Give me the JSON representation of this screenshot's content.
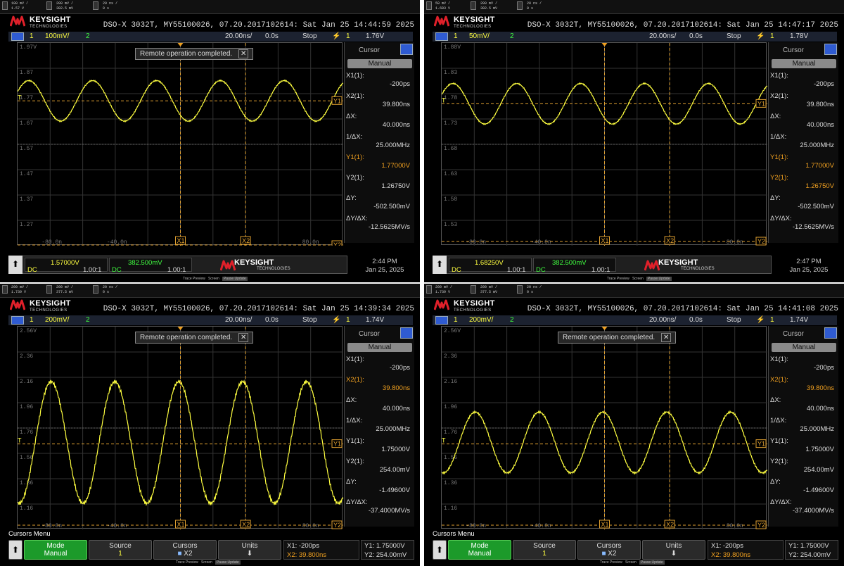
{
  "panels": [
    {
      "topbar": {
        "ch1_scale": "100 mV /",
        "ch1_offset": "1.57 V",
        "ch2_scale": "200 mV /",
        "ch2_offset": "382.5 mV",
        "time_scale": "20 ns /",
        "time_delay": "0 s"
      },
      "header": {
        "model": "DSO-X 3032T, MY55100026, 07.20.2017102614: Sat Jan 25 14:44:59 2025"
      },
      "channel_bar": {
        "ch1": "1",
        "scale": "100mV/",
        "ch2": "2",
        "timebase": "20.00ns/",
        "delay": "0.0s",
        "run": "Stop",
        "trig_ch": "1",
        "trig_level": "1.76V"
      },
      "y_labels": [
        "1.97V",
        "1.87",
        "1.77",
        "1.67",
        "1.57",
        "1.47",
        "1.37",
        "1.27"
      ],
      "x_labels": [
        "-80.0n",
        "-40.0n",
        "80.0n"
      ],
      "toast": "Remote operation completed.",
      "cursor": {
        "title": "Cursor",
        "mode": "Manual",
        "rows": [
          [
            "X1(1):",
            "-200ps"
          ],
          [
            "X2(1):",
            "39.800ns"
          ],
          [
            "ΔX:",
            "40.000ns"
          ],
          [
            "1/ΔX:",
            "25.000MHz"
          ],
          [
            "Y1(1):",
            "1.77000V"
          ],
          [
            "Y2(1):",
            "1.26750V"
          ],
          [
            "ΔY:",
            "-502.500mV"
          ],
          [
            "ΔY/ΔX:",
            "-12.5625MV/s"
          ]
        ],
        "highlight": [
          4
        ]
      },
      "markers": {
        "y1": "Y1",
        "y2": "Y2",
        "x1": "X1",
        "x2": "X2",
        "t": "T"
      },
      "bottom": {
        "ch1_offset": "1.57000V",
        "ch1_coupling": "DC",
        "ch1_probe": "1.00:1",
        "ch2_offset": "382.500mV",
        "ch2_coupling": "DC",
        "ch2_probe": "1.00:1",
        "brand": "KEYSIGHT",
        "brand_sub": "TECHNOLOGIES",
        "time": "2:44 PM",
        "date": "Jan 25, 2025"
      },
      "wave": {
        "center": 1.77,
        "amplitude": 0.07,
        "y_top": 1.97,
        "y_bottom": 1.27,
        "cycles": 5.1
      }
    },
    {
      "topbar": {
        "ch1_scale": "50 mV /",
        "ch1_offset": "1.683 V",
        "ch2_scale": "200 mV /",
        "ch2_offset": "382.5 mV",
        "time_scale": "20 ns /",
        "time_delay": "0 s"
      },
      "header": {
        "model": "DSO-X 3032T, MY55100026, 07.20.2017102614: Sat Jan 25 14:47:17 2025"
      },
      "channel_bar": {
        "ch1": "1",
        "scale": "50mV/",
        "ch2": "2",
        "timebase": "20.00ns/",
        "delay": "0.0s",
        "run": "Stop",
        "trig_ch": "1",
        "trig_level": "1.78V"
      },
      "y_labels": [
        "1.88V",
        "1.83",
        "1.78",
        "1.73",
        "1.68",
        "1.63",
        "1.58",
        "1.53"
      ],
      "x_labels": [
        "-80.0n",
        "-40.0n",
        "80.0n"
      ],
      "toast": "",
      "cursor": {
        "title": "Cursor",
        "mode": "Manual",
        "rows": [
          [
            "X1(1):",
            "-200ps"
          ],
          [
            "X2(1):",
            "39.800ns"
          ],
          [
            "ΔX:",
            "40.000ns"
          ],
          [
            "1/ΔX:",
            "25.000MHz"
          ],
          [
            "Y1(1):",
            "1.77000V"
          ],
          [
            "Y2(1):",
            "1.26750V"
          ],
          [
            "ΔY:",
            "-502.500mV"
          ],
          [
            "ΔY/ΔX:",
            "-12.5625MV/s"
          ]
        ],
        "highlight": [
          4,
          5
        ]
      },
      "markers": {
        "y1": "Y1",
        "y2": "Y2",
        "x1": "X1",
        "x2": "X2",
        "t": "T"
      },
      "bottom": {
        "ch1_offset": "1.68250V",
        "ch1_coupling": "DC",
        "ch1_probe": "1.00:1",
        "ch2_offset": "382.500mV",
        "ch2_coupling": "DC",
        "ch2_probe": "1.00:1",
        "brand": "KEYSIGHT",
        "brand_sub": "TECHNOLOGIES",
        "time": "2:47 PM",
        "date": "Jan 25, 2025"
      },
      "wave": {
        "center": 1.775,
        "amplitude": 0.035,
        "y_top": 1.88,
        "y_bottom": 1.53,
        "cycles": 5.1
      }
    },
    {
      "topbar": {
        "ch1_scale": "200 mV /",
        "ch1_offset": "1.739 V",
        "ch2_scale": "200 mV /",
        "ch2_offset": "377.5 mV",
        "time_scale": "20 ns /",
        "time_delay": "0 s"
      },
      "header": {
        "model": "DSO-X 3032T, MY55100026, 07.20.2017102614: Sat Jan 25 14:39:34 2025"
      },
      "channel_bar": {
        "ch1": "1",
        "scale": "200mV/",
        "ch2": "2",
        "timebase": "20.00ns/",
        "delay": "0.0s",
        "run": "Stop",
        "trig_ch": "1",
        "trig_level": "1.74V"
      },
      "y_labels": [
        "2.56V",
        "2.36",
        "2.16",
        "1.96",
        "1.76",
        "1.56",
        "1.36",
        "1.16"
      ],
      "x_labels": [
        "-80.0n",
        "-40.0n",
        "80.0n"
      ],
      "toast": "Remote operation completed.",
      "cursor": {
        "title": "Cursor",
        "mode": "Manual",
        "rows": [
          [
            "X1(1):",
            "-200ps"
          ],
          [
            "X2(1):",
            "39.800ns"
          ],
          [
            "ΔX:",
            "40.000ns"
          ],
          [
            "1/ΔX:",
            "25.000MHz"
          ],
          [
            "Y1(1):",
            "1.75000V"
          ],
          [
            "Y2(1):",
            "254.00mV"
          ],
          [
            "ΔY:",
            "-1.49600V"
          ],
          [
            "ΔY/ΔX:",
            "-37.4000MV/s"
          ]
        ],
        "highlight": [
          1
        ]
      },
      "markers": {
        "y1": "Y1",
        "y2": "Y2",
        "x1": "X1",
        "x2": "X2",
        "t": "T"
      },
      "menu": {
        "title": "Cursors Menu",
        "mode_label": "Mode",
        "mode_value": "Manual",
        "source_label": "Source",
        "source_value": "1",
        "cursors_label": "Cursors",
        "cursors_value": "X2",
        "units_label": "Units",
        "x1": "X1: -200ps",
        "x2": "X2: 39.800ns",
        "y1": "Y1: 1.75000V",
        "y2": "Y2: 254.00mV"
      },
      "wave": {
        "center": 1.76,
        "amplitude": 0.42,
        "y_top": 2.56,
        "y_bottom": 1.16,
        "cycles": 5.1
      }
    },
    {
      "topbar": {
        "ch1_scale": "200 mV /",
        "ch1_offset": "1.739 V",
        "ch2_scale": "200 mV /",
        "ch2_offset": "377.5 mV",
        "time_scale": "20 ns /",
        "time_delay": "0 s"
      },
      "header": {
        "model": "DSO-X 3032T, MY55100026, 07.20.2017102614: Sat Jan 25 14:41:08 2025"
      },
      "channel_bar": {
        "ch1": "1",
        "scale": "200mV/",
        "ch2": "2",
        "timebase": "20.00ns/",
        "delay": "0.0s",
        "run": "Stop",
        "trig_ch": "1",
        "trig_level": "1.74V"
      },
      "y_labels": [
        "2.56V",
        "2.36",
        "2.16",
        "1.96",
        "1.76",
        "1.56",
        "1.36",
        "1.16"
      ],
      "x_labels": [
        "-80.0n",
        "-40.0n",
        "80.0n"
      ],
      "toast": "Remote operation completed.",
      "cursor": {
        "title": "Cursor",
        "mode": "Manual",
        "rows": [
          [
            "X1(1):",
            "-200ps"
          ],
          [
            "X2(1):",
            "39.800ns"
          ],
          [
            "ΔX:",
            "40.000ns"
          ],
          [
            "1/ΔX:",
            "25.000MHz"
          ],
          [
            "Y1(1):",
            "1.75000V"
          ],
          [
            "Y2(1):",
            "254.00mV"
          ],
          [
            "ΔY:",
            "-1.49600V"
          ],
          [
            "ΔY/ΔX:",
            "-37.4000MV/s"
          ]
        ],
        "highlight": [
          1
        ]
      },
      "markers": {
        "y1": "Y1",
        "y2": "Y2",
        "x1": "X1",
        "x2": "X2",
        "t": "T"
      },
      "menu": {
        "title": "Cursors Menu",
        "mode_label": "Mode",
        "mode_value": "Manual",
        "source_label": "Source",
        "source_value": "1",
        "cursors_label": "Cursors",
        "cursors_value": "X2",
        "units_label": "Units",
        "x1": "X1: -200ps",
        "x2": "X2: 39.800ns",
        "y1": "Y1: 1.75000V",
        "y2": "Y2: 254.00mV"
      },
      "wave": {
        "center": 1.76,
        "amplitude": 0.21,
        "y_top": 2.56,
        "y_bottom": 1.16,
        "cycles": 5.1
      }
    }
  ],
  "footer": {
    "trace_preview": "Trace Preview",
    "screen": "Screen",
    "pause_update": "Pause Update"
  },
  "colors": {
    "trace": "#ffff40",
    "cursor": "#e0a030",
    "accent": "#2f5bd1",
    "green": "#1c9a2a"
  },
  "logo": {
    "name": "KEYSIGHT",
    "sub": "TECHNOLOGIES"
  }
}
